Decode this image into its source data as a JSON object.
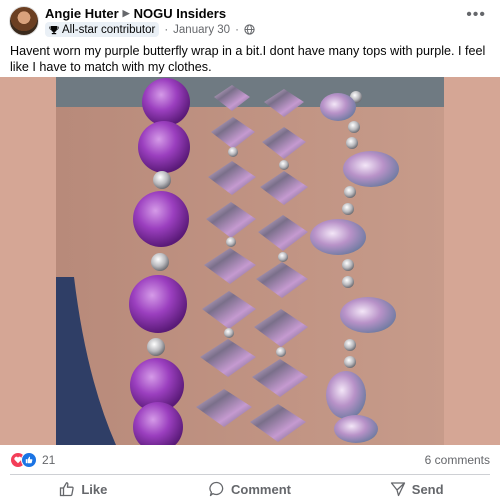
{
  "post": {
    "author": "Angie Huter",
    "group": "NOGU Insiders",
    "badge": "All-star contributor",
    "date": "January 30",
    "separator": "·",
    "more_label": "•••",
    "text": "Havent worn my purple butterfly wrap in a bit.I dont have many tops with purple. I feel like I have to match with my clothes."
  },
  "engagement": {
    "reaction_count": "21",
    "comments": "6 comments"
  },
  "actions": {
    "like": "Like",
    "comment": "Comment",
    "send": "Send"
  },
  "colors": {
    "background": "#d5a695",
    "heart": "#f33e58",
    "like": "#1b74e4",
    "muted": "#65676b"
  },
  "icons": [
    "avatar",
    "triangle-right-icon",
    "trophy-icon",
    "globe-icon",
    "more-icon",
    "heart-icon",
    "thumbs-up-icon",
    "comment-icon",
    "send-icon"
  ]
}
